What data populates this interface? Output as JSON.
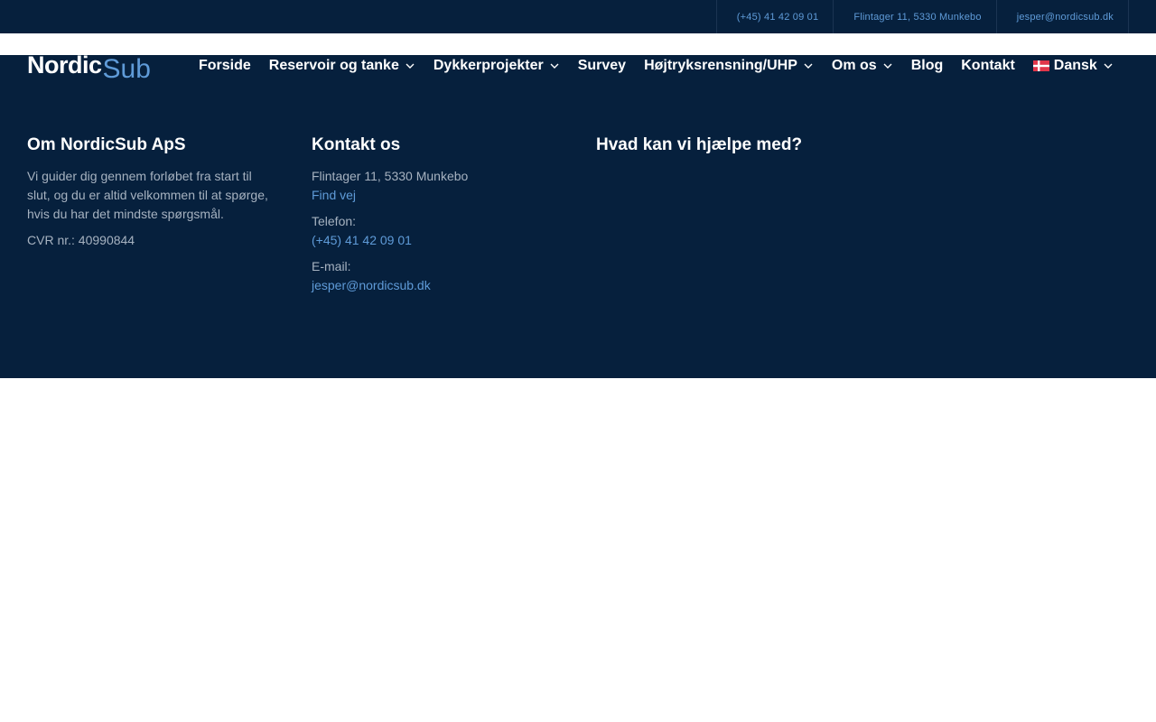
{
  "topbar": {
    "phone": "(+45) 41 42 09 01",
    "address": "Flintager 11, 5330 Munkebo",
    "email": "jesper@nordicsub.dk"
  },
  "logo": {
    "part1": "Nordic",
    "part2": "Sub"
  },
  "nav": {
    "items": [
      {
        "label": "Forside"
      },
      {
        "label": "Reservoir og tanke"
      },
      {
        "label": "Dykkerprojekter"
      },
      {
        "label": "Survey"
      },
      {
        "label": "Højtryksrensning/UHP"
      },
      {
        "label": "Om os"
      },
      {
        "label": "Blog"
      },
      {
        "label": "Kontakt"
      },
      {
        "label": "Dansk"
      }
    ]
  },
  "footer": {
    "about": {
      "title": "Om NordicSub ApS",
      "description": "Vi guider dig gennem forløbet fra start til slut, og du er altid velkommen til at spørge, hvis du har det mindste spørgsmål.",
      "cvr": "CVR nr.: 40990844"
    },
    "contact": {
      "title": "Kontakt os",
      "address": "Flintager 11, 5330 Munkebo",
      "directions": "Find vej",
      "phone_label": "Telefon:",
      "phone": "(+45) 41 42 09 01",
      "email_label": "E-mail:",
      "email": "jesper@nordicsub.dk"
    },
    "help": {
      "title": "Hvad kan vi hjælpe med?"
    }
  },
  "colors": {
    "dark_navy": "#06203d",
    "accent_blue": "#5f9bd8",
    "muted_text": "#a6b2c0"
  }
}
